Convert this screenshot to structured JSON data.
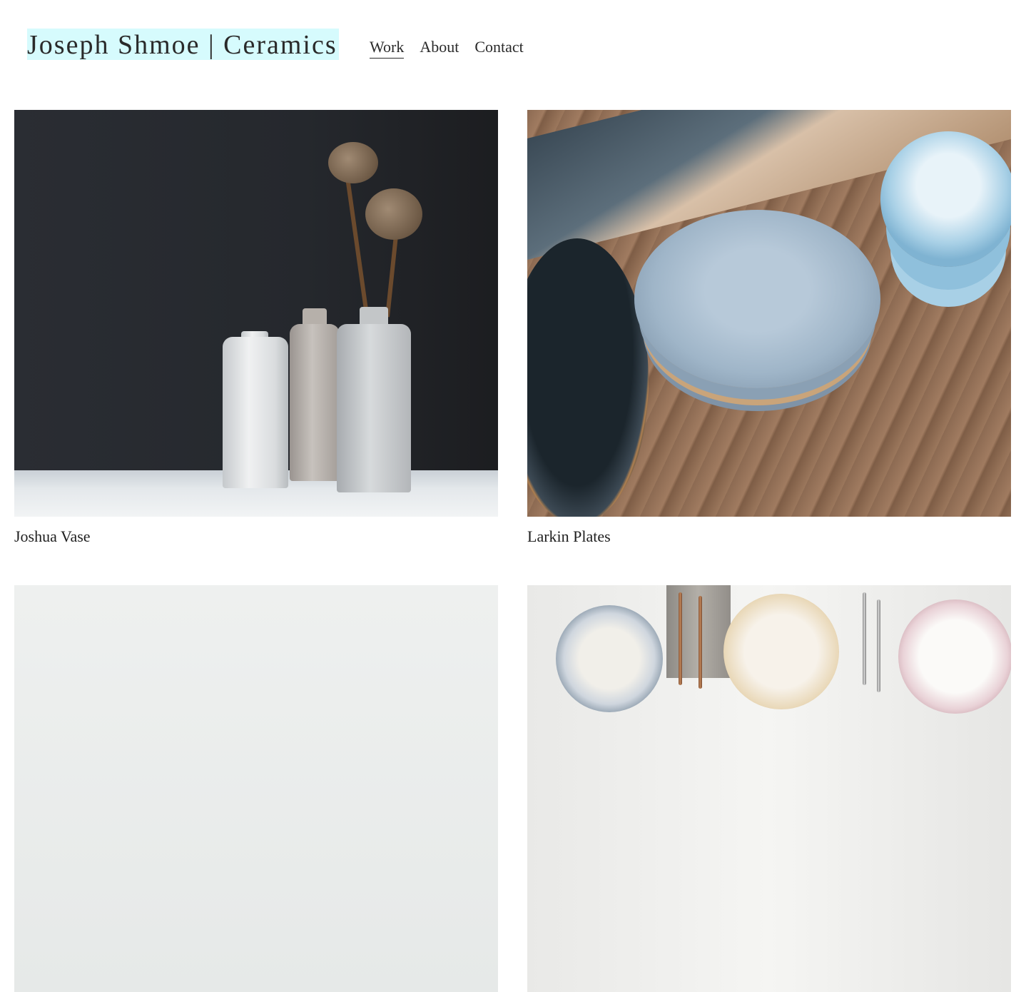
{
  "header": {
    "site_title": "Joseph Shmoe | Ceramics",
    "nav": [
      {
        "label": "Work",
        "active": true
      },
      {
        "label": "About",
        "active": false
      },
      {
        "label": "Contact",
        "active": false
      }
    ]
  },
  "gallery": {
    "items": [
      {
        "caption": "Joshua Vase",
        "image": "photo of three ceramic vases with dried poppy pods"
      },
      {
        "caption": "Larkin Plates",
        "image": "photo of blue and black plates and bowls on wooden board"
      },
      {
        "caption": "",
        "image": "photo with pale grey background"
      },
      {
        "caption": "",
        "image": "photo of vintage floral plates with copper cutlery"
      }
    ]
  },
  "colors": {
    "title_highlight": "#d6fbfd",
    "text": "#1f1f1f",
    "background": "#ffffff"
  }
}
